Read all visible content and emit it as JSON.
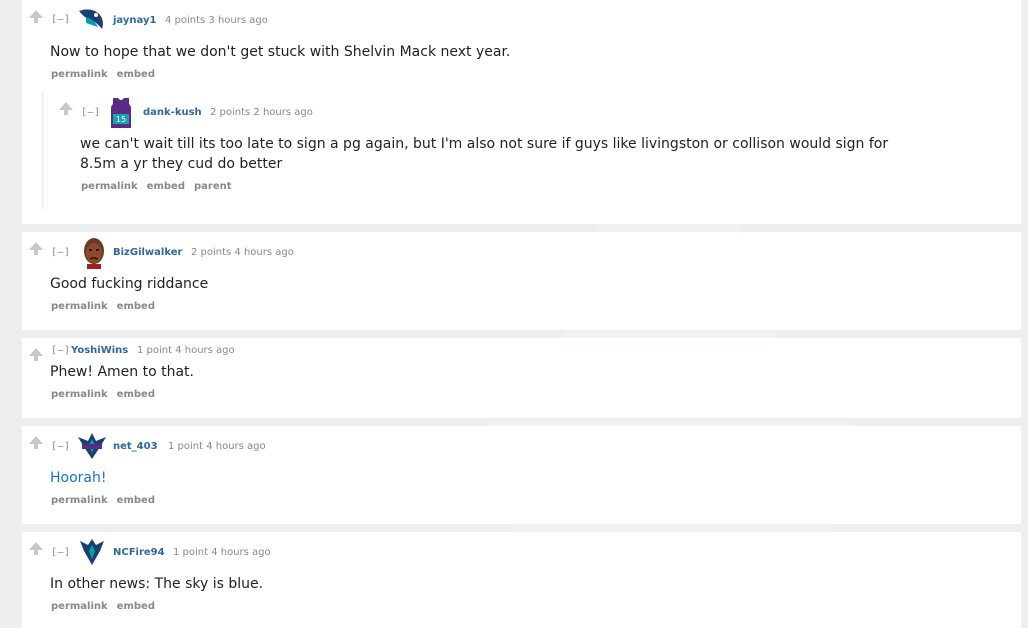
{
  "colors": {
    "author": "#336699",
    "link": "#1a73b8",
    "meta": "#888888",
    "background": "#eeeeee"
  },
  "comments": [
    {
      "collapse": "[–]",
      "author": "jaynay1",
      "flair_icon": "hornet-icon",
      "score": "4 points 3 hours ago",
      "body": "Now to hope that we don't get stuck with Shelvin Mack next year.",
      "buttons": [
        "permalink",
        "embed"
      ],
      "child": {
        "collapse": "[–]",
        "author": "dank-kush",
        "flair_icon": "jersey-icon",
        "score": "2 points 2 hours ago",
        "body": "we can't wait till its too late to sign a pg again, but I'm also not sure if guys like livingston or collison would sign for 8.5m a yr they cud do better",
        "buttons": [
          "permalink",
          "embed",
          "parent"
        ]
      }
    },
    {
      "collapse": "[–]",
      "author": "BizGilwalker",
      "flair_icon": "avatar-face-icon",
      "score": "2 points 4 hours ago",
      "body": "Good fucking riddance",
      "buttons": [
        "permalink",
        "embed"
      ]
    },
    {
      "collapse": "[–]",
      "author": "YoshiWins",
      "score": "1 point 4 hours ago",
      "body": "Phew! Amen to that.",
      "buttons": [
        "permalink",
        "embed"
      ]
    },
    {
      "collapse": "[–]",
      "author": "net_403",
      "flair_icon": "hornets-logo-icon",
      "score": "1 point 4 hours ago",
      "body": "Hoorah!",
      "buttons": [
        "permalink",
        "embed"
      ]
    },
    {
      "collapse": "[–]",
      "author": "NCFire94",
      "flair_icon": "hornets-logo-icon",
      "score": "1 point 4 hours ago",
      "body": "In other news: The sky is blue.",
      "buttons": [
        "permalink",
        "embed"
      ]
    }
  ]
}
